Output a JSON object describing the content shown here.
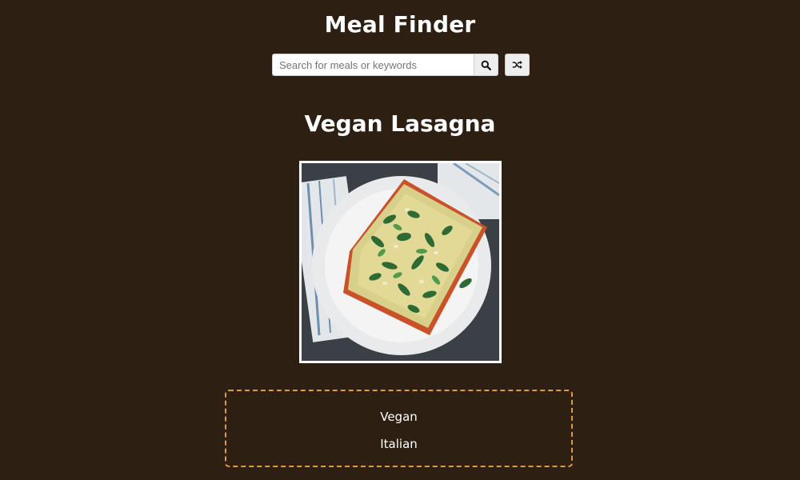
{
  "app": {
    "title": "Meal Finder"
  },
  "search": {
    "placeholder": "Search for meals or keywords",
    "value": "",
    "submit_icon": "search-icon",
    "random_icon": "shuffle-icon"
  },
  "meal": {
    "name": "Vegan Lasagna",
    "category": "Vegan",
    "area": "Italian"
  },
  "colors": {
    "background": "#2d2013",
    "accent_border": "#e09b3d",
    "text": "#ffffff"
  }
}
